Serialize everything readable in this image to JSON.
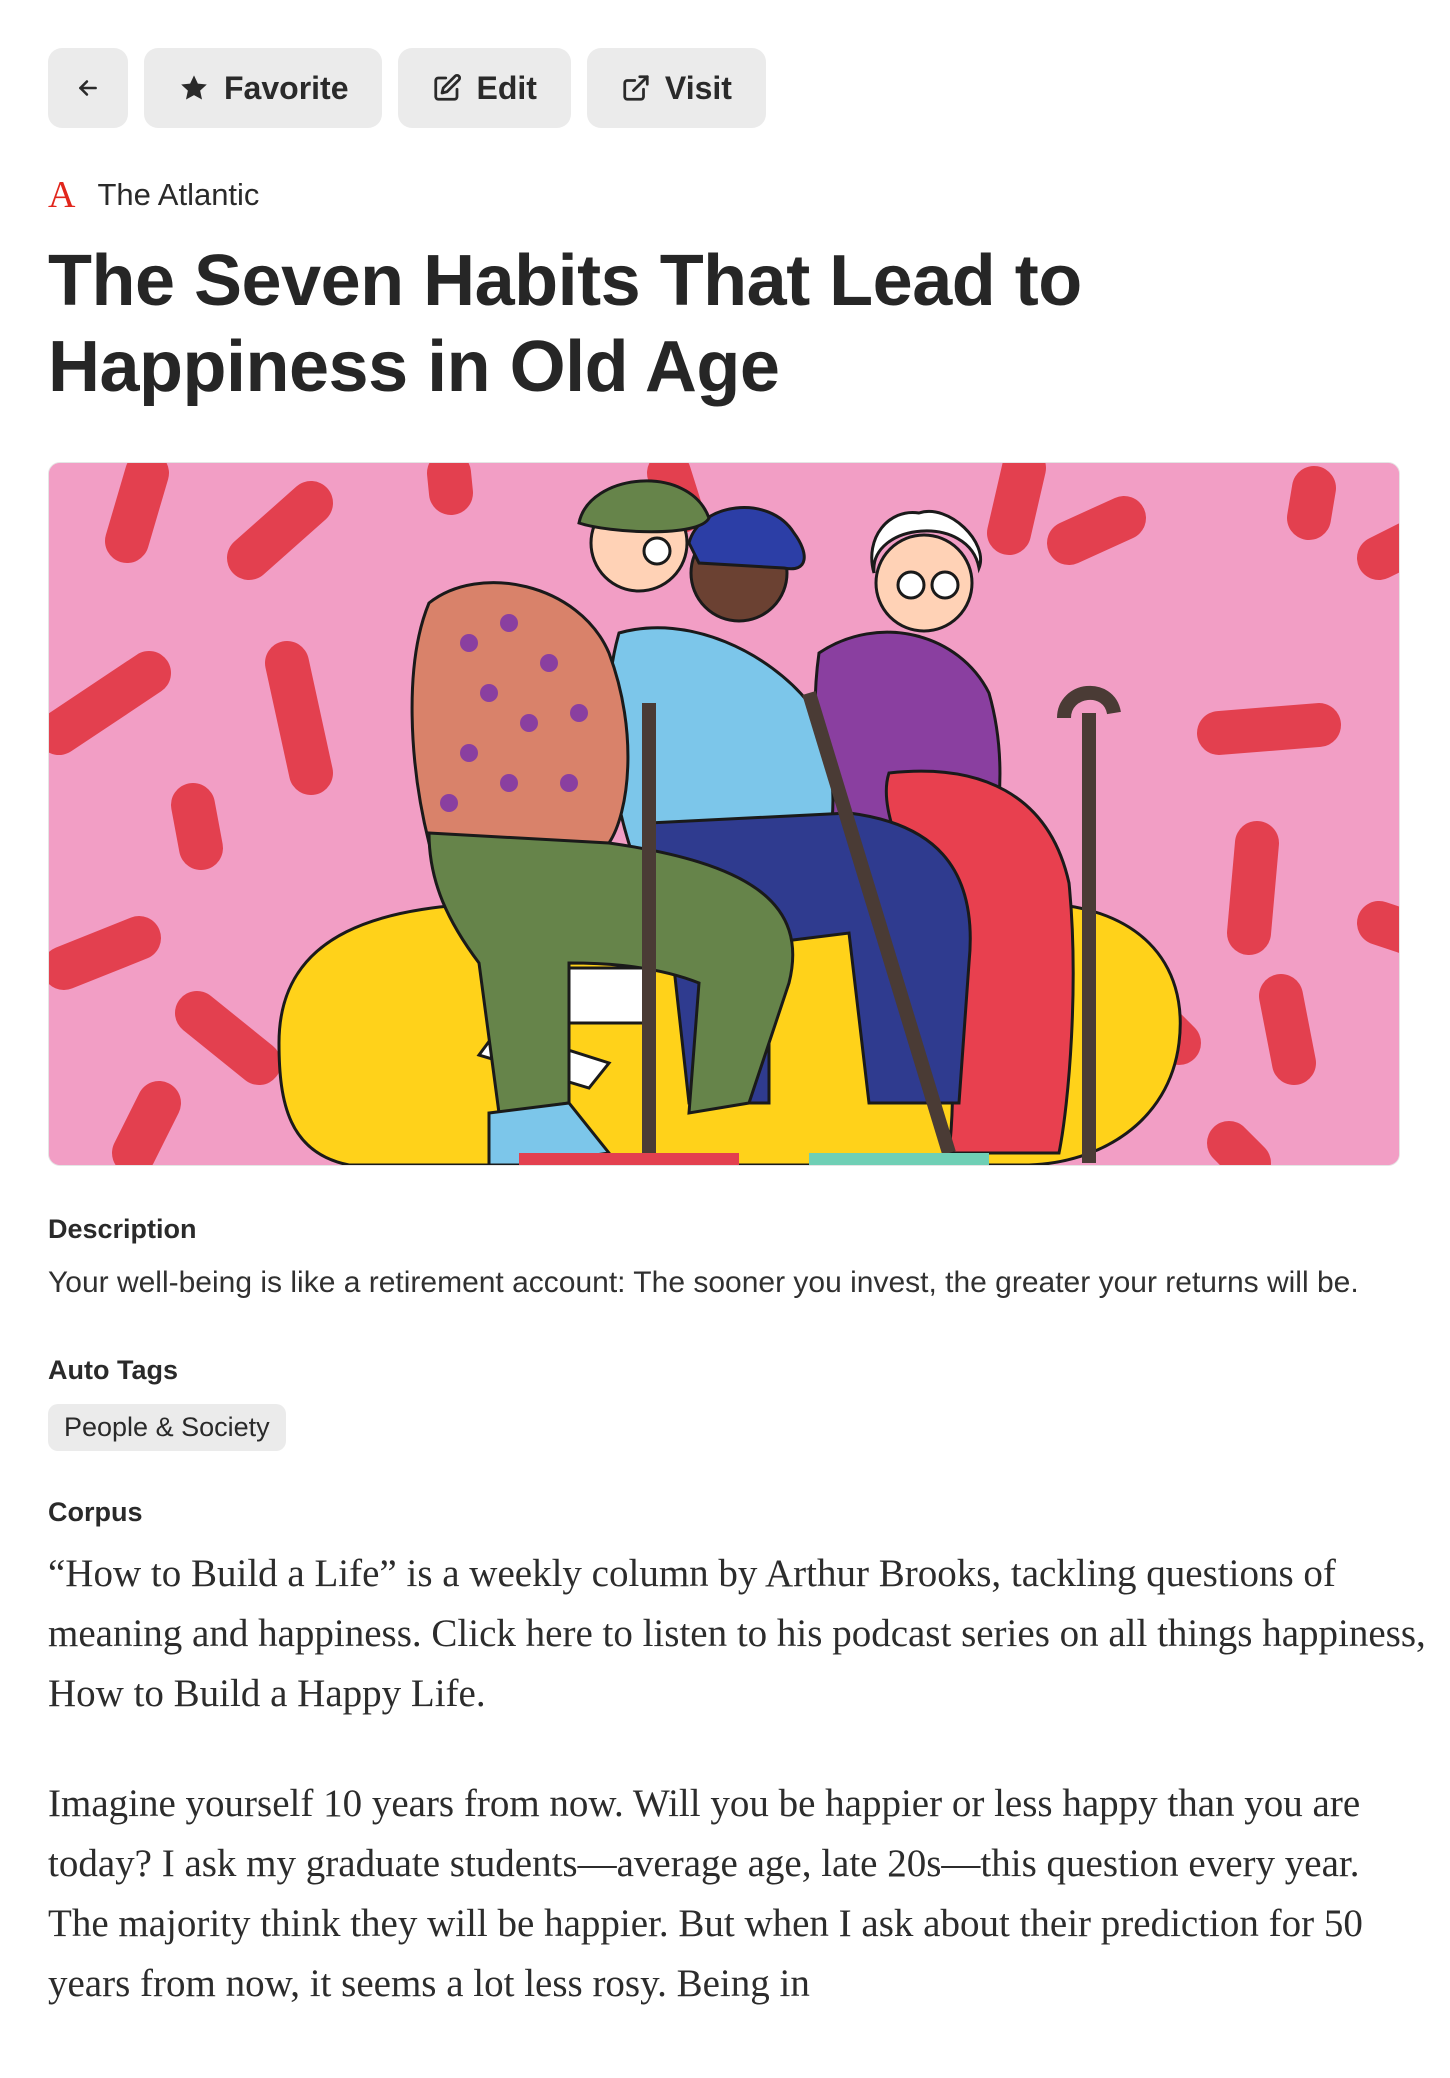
{
  "toolbar": {
    "back_icon": "arrow-left-icon",
    "favorite_icon": "star-icon",
    "favorite_label": "Favorite",
    "edit_icon": "edit-icon",
    "edit_label": "Edit",
    "visit_icon": "external-link-icon",
    "visit_label": "Visit"
  },
  "source": {
    "logo_text": "A",
    "name": "The Atlantic",
    "accent": "#e1261c"
  },
  "article": {
    "title": "The Seven Habits That Lead to Happiness in Old Age"
  },
  "description": {
    "label": "Description",
    "text": "Your well-being is like a retirement account: The sooner you invest, the greater your returns will be."
  },
  "auto_tags": {
    "label": "Auto Tags",
    "tags": [
      "People & Society"
    ]
  },
  "corpus": {
    "label": "Corpus",
    "paragraphs": [
      "“How to Build a Life” is a weekly column by Arthur Brooks, tackling questions of meaning and happiness. Click here to listen to his podcast series on all things happiness, How to Build a Happy Life.",
      "Imagine yourself 10 years from now. Will you be happier or less happy than you are today? I ask my graduate students—average age, late 20s—this question every year. The majority think they will be happier. But when I ask about their prediction for 50 years from now, it seems a lot less rosy. Being in"
    ]
  },
  "colors": {
    "button_bg": "#ebebeb",
    "hero_bg": "#f29ec5",
    "sprinkle": "#e3404f",
    "bench": "#ffd21a"
  }
}
